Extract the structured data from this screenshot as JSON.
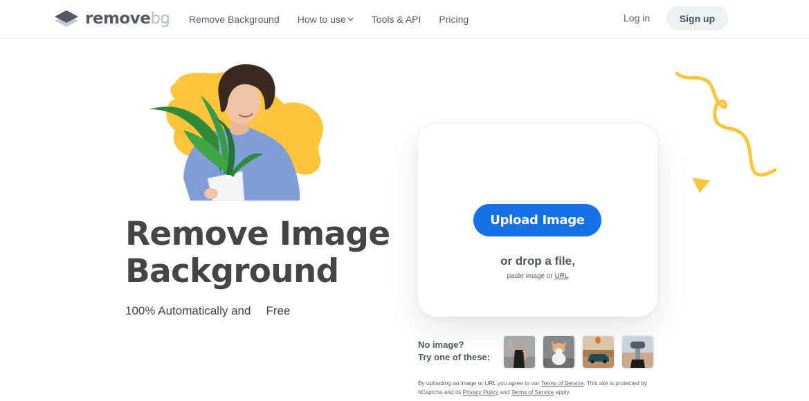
{
  "header": {
    "logo": {
      "primary": "remove",
      "secondary": "bg",
      "icon": "layers-logo-icon"
    },
    "nav": [
      {
        "label": "Remove Background",
        "has_dropdown": false
      },
      {
        "label": "How to use",
        "has_dropdown": true
      },
      {
        "label": "Tools & API",
        "has_dropdown": false
      },
      {
        "label": "Pricing",
        "has_dropdown": false
      }
    ],
    "login_label": "Log in",
    "signup_label": "Sign up"
  },
  "hero": {
    "image_alt": "Man holding a potted plant with yellow blob background",
    "title_line1": "Remove Image",
    "title_line2": "Background",
    "subtitle_prefix": "100% Automatically and",
    "subtitle_highlight": "Free"
  },
  "upload": {
    "button_label": "Upload Image",
    "drop_text": "or drop a file,",
    "paste_prefix": "paste image or",
    "paste_link": "URL"
  },
  "samples": {
    "line1": "No image?",
    "line2": "Try one of these:",
    "items": [
      {
        "alt": "Woman flexing arm"
      },
      {
        "alt": "Corgi dog"
      },
      {
        "alt": "Vintage car with hot air balloon"
      },
      {
        "alt": "Coin-operated binoculars"
      }
    ]
  },
  "legal": {
    "part1": "By uploading an image or URL you agree to our",
    "tos_link": "Terms of Service",
    "part2": ". This site is protected by hCaptcha and its",
    "privacy_link": "Privacy Policy",
    "part3": "and",
    "tos_link2": "Terms of Service",
    "part4": "apply."
  },
  "colors": {
    "accent_blue": "#1472e6",
    "accent_yellow": "#ffc43a",
    "text_dark": "#454545"
  }
}
